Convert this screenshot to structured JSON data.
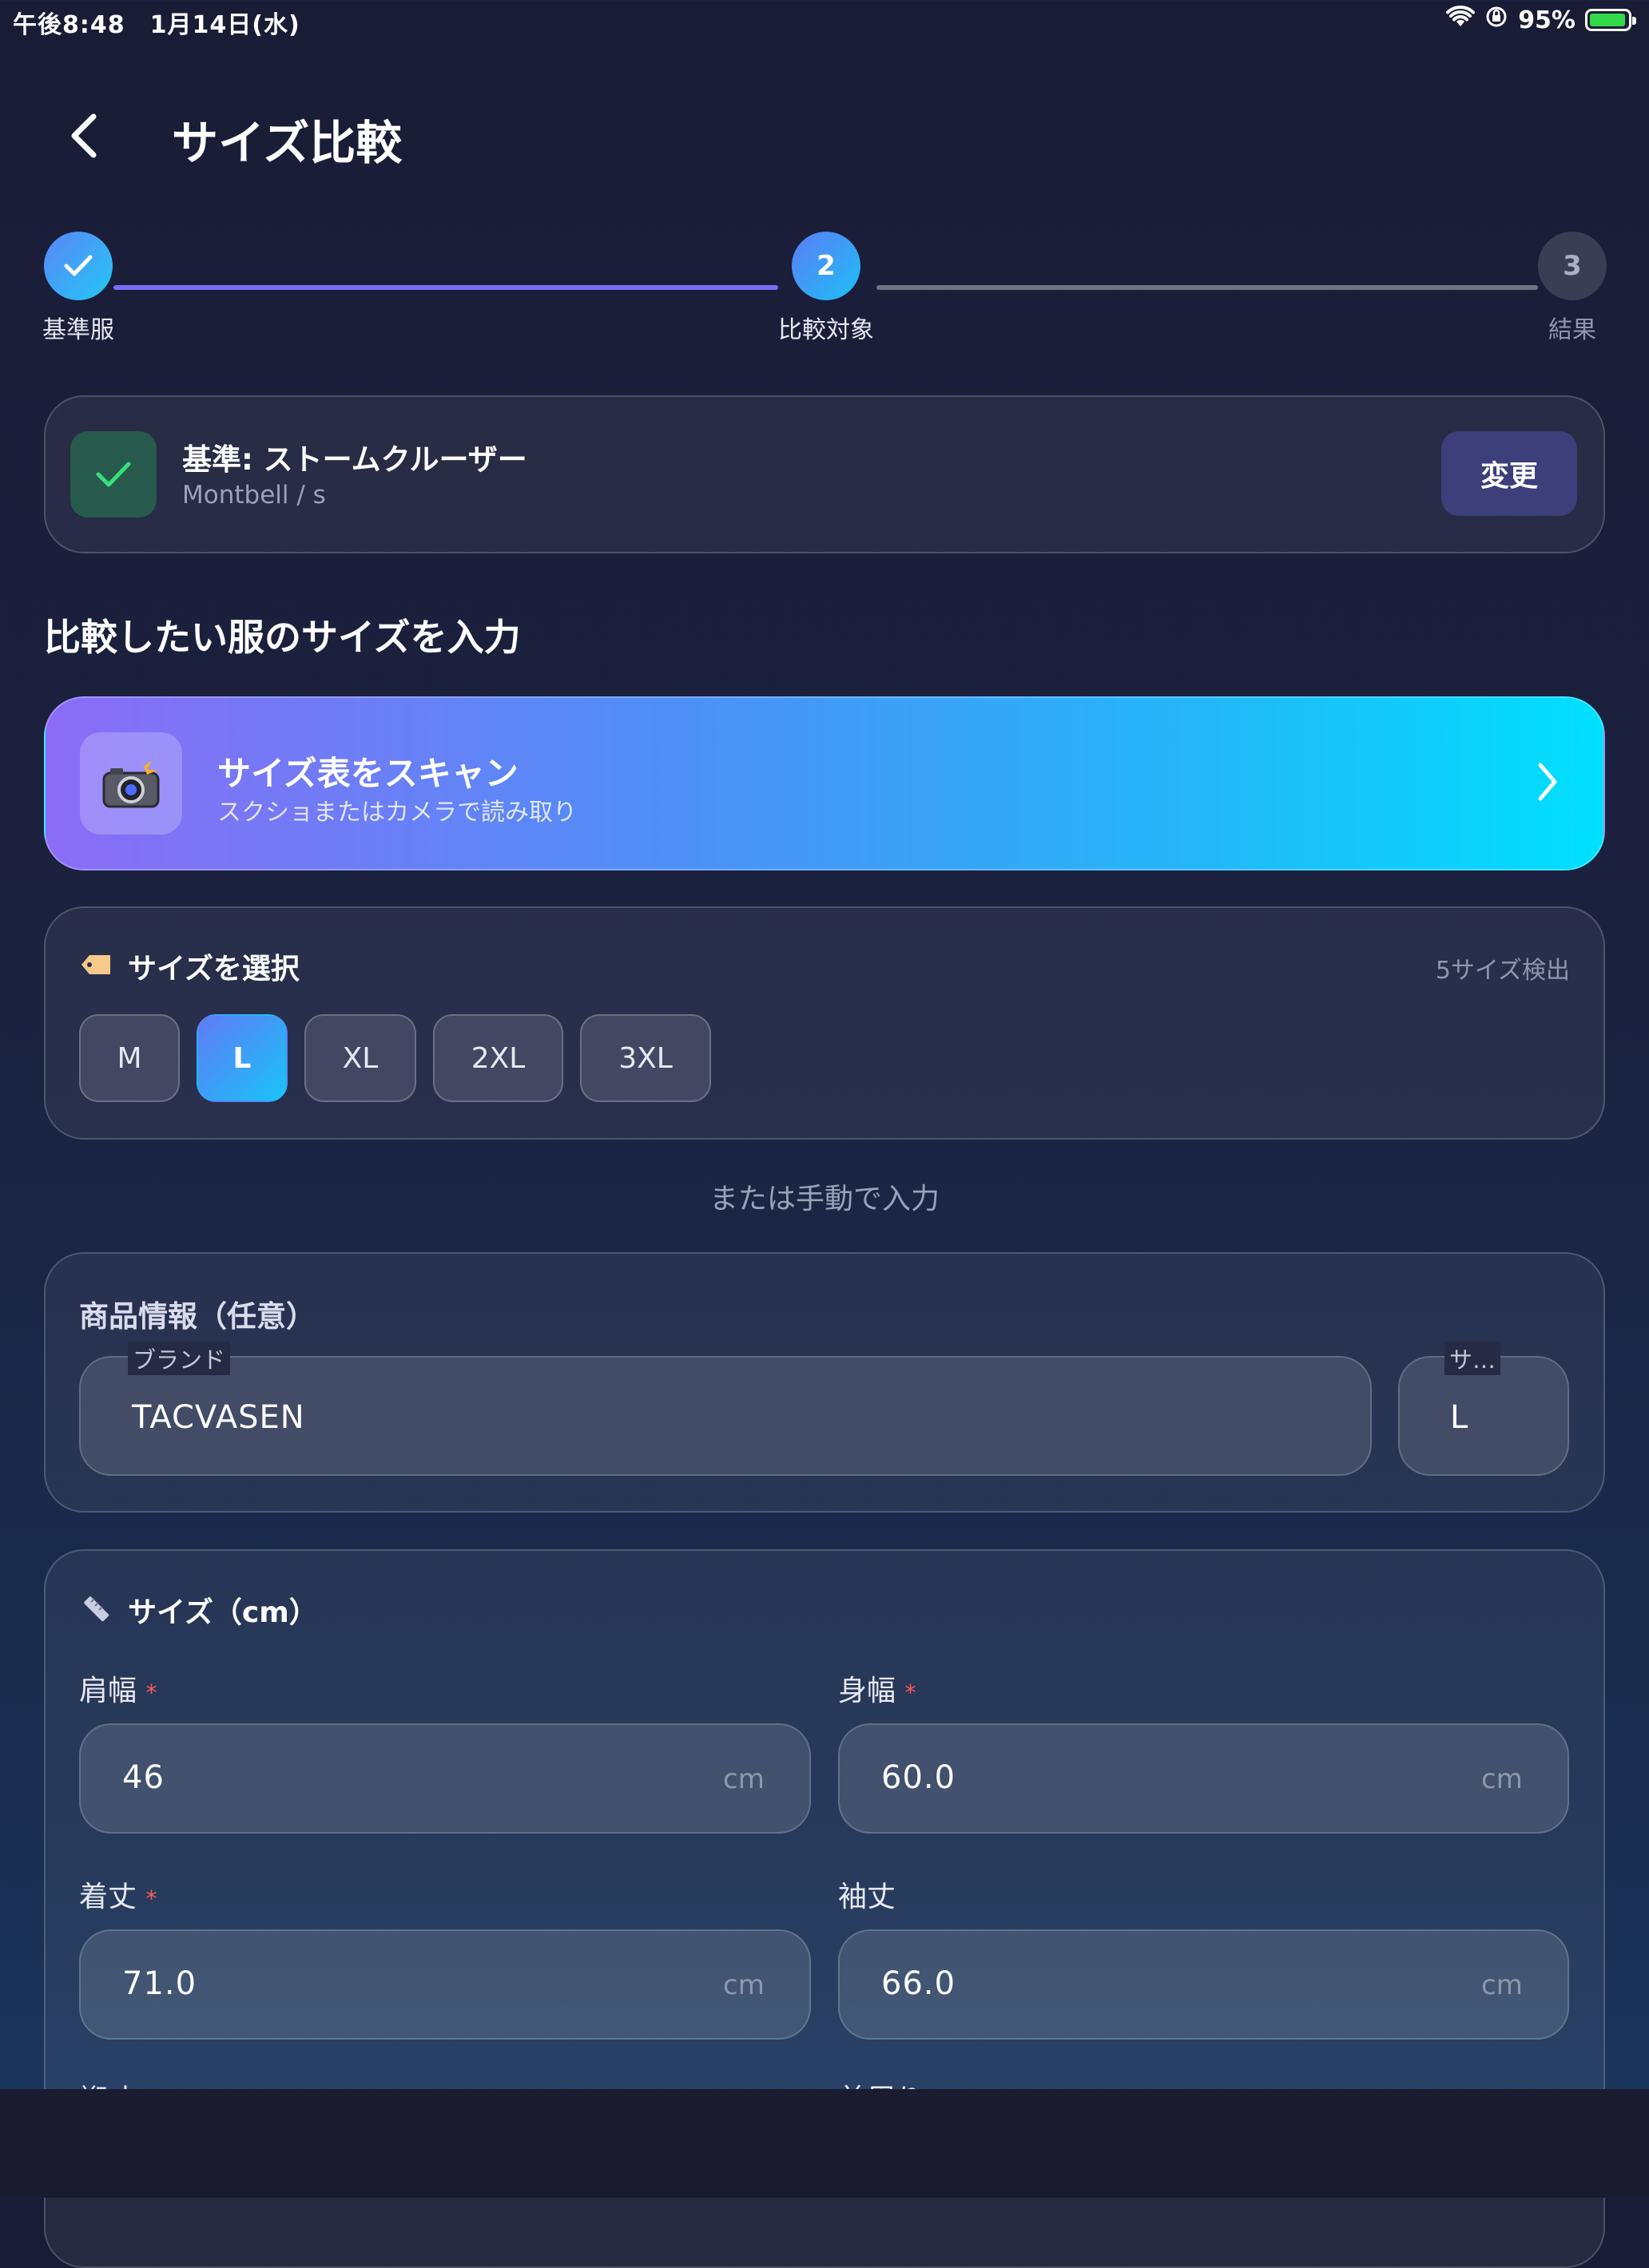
{
  "status_bar": {
    "time": "午後8:48　1月14日(水)",
    "battery": "95%",
    "battery_level": 0.95,
    "icons": [
      "wifi-icon",
      "orientation-lock-icon",
      "battery-charging-icon"
    ]
  },
  "header": {
    "title": "サイズ比較",
    "back_icon": "chevron-left-icon"
  },
  "stepper": {
    "steps": [
      {
        "number": "1",
        "label": "基準服",
        "state": "done"
      },
      {
        "number": "2",
        "label": "比較対象",
        "state": "active"
      },
      {
        "number": "3",
        "label": "結果",
        "state": "todo"
      }
    ],
    "colors": {
      "active_line": "#7b6cf6",
      "inactive_line": "#6d7284"
    }
  },
  "base_card": {
    "title": "基準: ストームクルーザー",
    "subtitle": "Montbell / s",
    "change_label": "変更"
  },
  "section_title": "比較したい服のサイズを入力",
  "scan": {
    "title": "サイズ表をスキャン",
    "subtitle": "スクショまたはカメラで読み取り",
    "icon": "camera-flash-icon"
  },
  "size_select": {
    "title": "サイズを選択",
    "detected": "5サイズ検出",
    "options": [
      "M",
      "L",
      "XL",
      "2XL",
      "3XL"
    ],
    "selected": "L",
    "icon": "tag-icon"
  },
  "manual_hint": "または手動で入力",
  "product_info": {
    "title": "商品情報（任意）",
    "brand_label": "ブランド",
    "brand_value": "TACVASEN",
    "size_label": "サ…",
    "size_value": "L"
  },
  "measurements": {
    "title": "サイズ（cm）",
    "icon": "ruler-icon",
    "unit": "cm",
    "required_mark": "*",
    "fields": [
      {
        "label": "肩幅",
        "value": "46",
        "required": true
      },
      {
        "label": "身幅",
        "value": "60.0",
        "required": true
      },
      {
        "label": "着丈",
        "value": "71.0",
        "required": true
      },
      {
        "label": "袖丈",
        "value": "66.0",
        "required": false
      }
    ],
    "partial_labels": [
      "裄丈",
      "首周り"
    ]
  },
  "accent_colors": {
    "gradient_start": "#8b6cf6",
    "gradient_end": "#00e0ff",
    "check_green": "#34e07a",
    "required_red": "#ff5a5a"
  }
}
